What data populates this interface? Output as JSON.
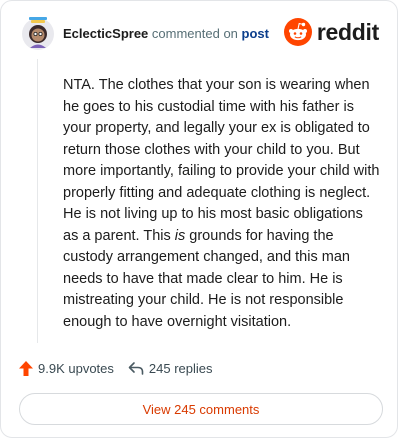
{
  "header": {
    "username": "EclecticSpree",
    "action_text": "commented on",
    "post_link": "post",
    "brand": "reddit"
  },
  "comment": {
    "before_em": "NTA. The clothes that your son is wearing when he goes to his custodial time with his father is your property, and legally your ex is obligated to return those clothes with your child to you. But more importantly, failing to provide your child with properly fitting and adequate clothing is neglect. He is not living up to his most basic obligations as a parent. This ",
    "em": "is",
    "after_em": " grounds for having the custody arrangement changed, and this man needs to have that made clear to him. He is mistreating your child. He is not responsible enough to have overnight visitation."
  },
  "stats": {
    "upvotes": "9.9K upvotes",
    "replies": "245 replies"
  },
  "actions": {
    "view_comments": "View 245 comments"
  },
  "colors": {
    "reddit_orange": "#ff4500",
    "post_link": "#0b3e8c",
    "view_button_text": "#d93a00"
  },
  "icons": [
    "avatar",
    "reddit-logo-icon",
    "upvote-arrow-icon",
    "reply-arrow-icon"
  ]
}
